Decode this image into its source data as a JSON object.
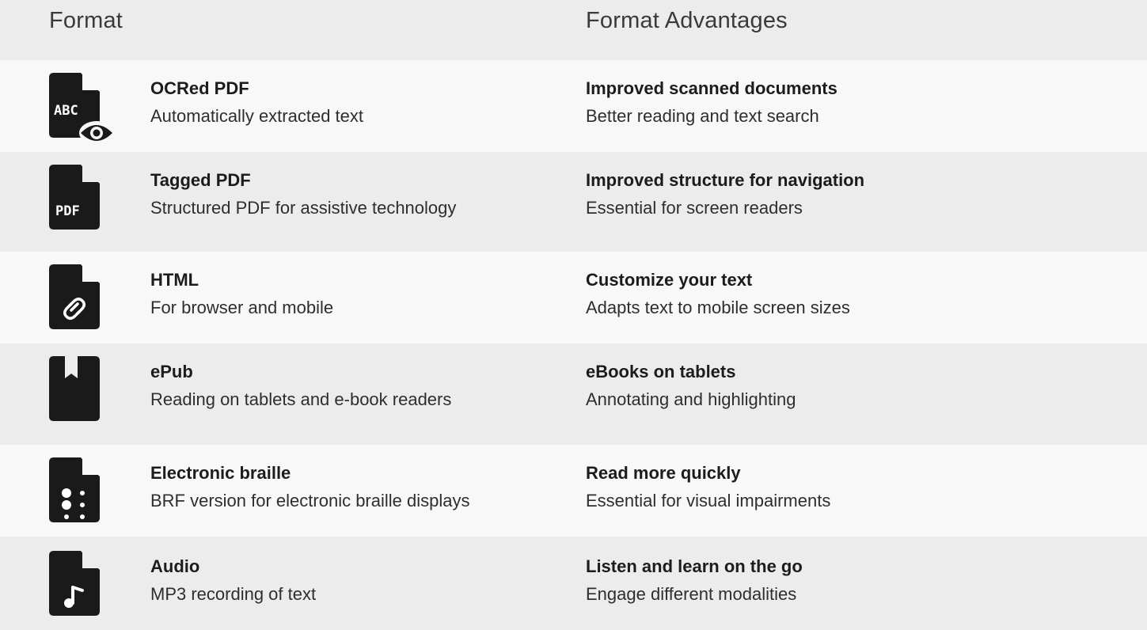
{
  "header": {
    "format_label": "Format",
    "advantages_label": "Format Advantages"
  },
  "colors": {
    "row_light": "#f8f8f8",
    "row_dark": "#ececec",
    "icon": "#1a1a1a"
  },
  "rows": [
    {
      "icon": "file-ocr-icon",
      "name": "OCRed PDF",
      "description": "Automatically extracted text",
      "advantage_title": "Improved scanned documents",
      "advantage_description": "Better reading and text search"
    },
    {
      "icon": "file-pdf-icon",
      "name": "Tagged PDF",
      "description": "Structured PDF for assistive technology",
      "advantage_title": "Improved structure for navigation",
      "advantage_description": "Essential for screen readers"
    },
    {
      "icon": "file-link-icon",
      "name": "HTML",
      "description": "For browser and mobile",
      "advantage_title": "Customize your text",
      "advantage_description": "Adapts text to mobile screen sizes"
    },
    {
      "icon": "bookmark-icon",
      "name": "ePub",
      "description": "Reading on tablets and e-book readers",
      "advantage_title": "eBooks on tablets",
      "advantage_description": "Annotating and highlighting"
    },
    {
      "icon": "file-braille-icon",
      "name": "Electronic braille",
      "description": "BRF version for electronic braille displays",
      "advantage_title": "Read more quickly",
      "advantage_description": "Essential for visual impairments"
    },
    {
      "icon": "file-audio-icon",
      "name": "Audio",
      "description": "MP3 recording of text",
      "advantage_title": "Listen and learn on the go",
      "advantage_description": "Engage different modalities"
    }
  ]
}
